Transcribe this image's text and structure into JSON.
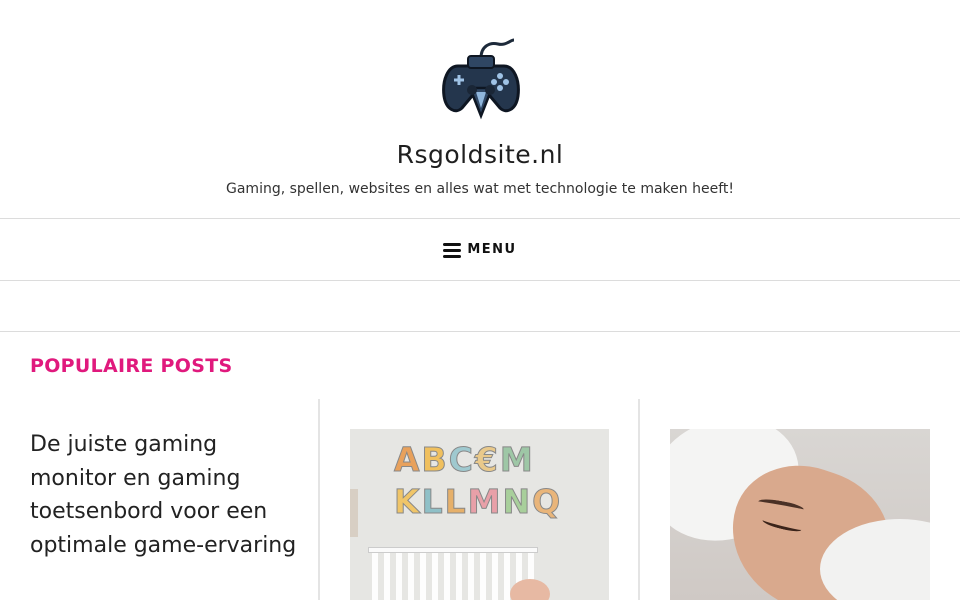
{
  "site": {
    "title": "Rsgoldsite.nl",
    "tagline": "Gaming, spellen, websites en alles wat met technologie te maken heeft!",
    "logo_icon": "gamepad-logo-icon"
  },
  "nav": {
    "menu_label": "MENU",
    "menu_icon": "hamburger-icon"
  },
  "popular": {
    "heading": "POPULAIRE POSTS",
    "accent_color": "#e0197d",
    "posts": [
      {
        "title": "De juiste gaming monitor en gaming toetsenbord voor een optimale game-ervaring"
      },
      {
        "image": "nursery-alphabet-wall-image"
      },
      {
        "image": "facial-treatment-image"
      }
    ]
  },
  "nursery_letters": {
    "row1": [
      "A",
      "B",
      "C",
      "€",
      "M"
    ],
    "row2": [
      "K",
      "L",
      "L",
      "M",
      "N",
      "Q"
    ]
  }
}
